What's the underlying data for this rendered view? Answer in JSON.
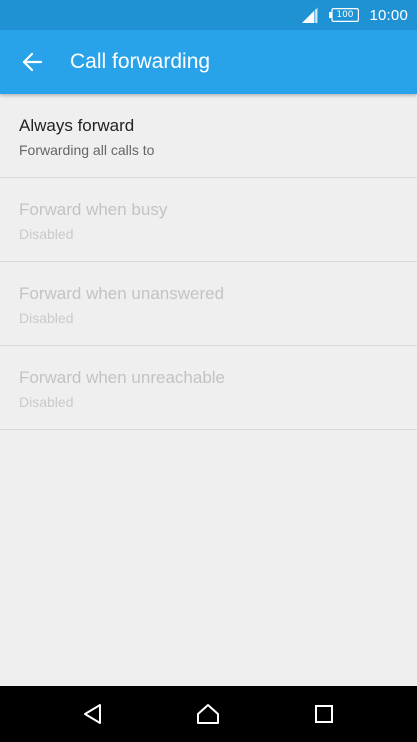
{
  "status_bar": {
    "battery_level": "100",
    "time": "10:00",
    "icons": [
      "signal-icon",
      "battery-icon"
    ]
  },
  "app_bar": {
    "title": "Call forwarding",
    "back_icon": "arrow-back-icon"
  },
  "settings": {
    "items": [
      {
        "title": "Always forward",
        "summary": "Forwarding all calls to",
        "enabled": true
      },
      {
        "title": "Forward when busy",
        "summary": "Disabled",
        "enabled": false
      },
      {
        "title": "Forward when unanswered",
        "summary": "Disabled",
        "enabled": false
      },
      {
        "title": "Forward when unreachable",
        "summary": "Disabled",
        "enabled": false
      }
    ]
  },
  "nav_bar": {
    "icons": [
      "nav-back-icon",
      "nav-home-icon",
      "nav-recents-icon"
    ]
  },
  "colors": {
    "status_bar": "#1f92d4",
    "app_bar": "#28a3ea",
    "background": "#efefef",
    "nav_bar": "#000000",
    "text_primary": "#222222",
    "text_secondary": "#666666",
    "text_disabled": "#c3c3c3"
  }
}
